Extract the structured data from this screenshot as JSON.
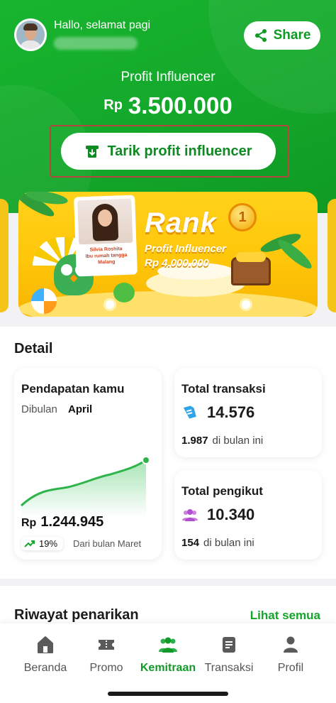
{
  "header": {
    "greeting": "Hallo, selamat pagi",
    "share_label": "Share",
    "profit_label": "Profit Influencer",
    "currency": "Rp",
    "profit_amount": "3.500.000",
    "withdraw_label": "Tarik profit influencer"
  },
  "banner": {
    "title": "Rank",
    "subtitle": "Profit Influencer",
    "amount": "Rp 4.000.000",
    "medal_number": "1",
    "photo_caption": "Silvia Roshita\nIbu rumah tangga\nMalang"
  },
  "detail": {
    "title": "Detail",
    "income": {
      "title": "Pendapatan kamu",
      "period_label": "Dibulan",
      "month": "April",
      "currency": "Rp",
      "amount": "1.244.945",
      "trend_percent": "19%",
      "trend_text": "Dari bulan Maret"
    },
    "transactions": {
      "title": "Total transaksi",
      "value": "14.576",
      "month_value": "1.987",
      "month_text": "di bulan ini"
    },
    "followers": {
      "title": "Total pengikut",
      "value": "10.340",
      "month_value": "154",
      "month_text": "di bulan ini"
    }
  },
  "riwayat": {
    "title": "Riwayat penarikan",
    "see_all": "Lihat semua"
  },
  "bottom_nav": {
    "items": [
      {
        "label": "Beranda",
        "icon": "home-icon"
      },
      {
        "label": "Promo",
        "icon": "ticket-icon"
      },
      {
        "label": "Kemitraan",
        "icon": "partners-icon"
      },
      {
        "label": "Transaksi",
        "icon": "receipt-icon"
      },
      {
        "label": "Profil",
        "icon": "person-icon"
      }
    ],
    "active": "Kemitraan"
  },
  "colors": {
    "brand_green": "#13a62a",
    "banner_yellow": "#ffc60a",
    "withdraw_highlight_border": "#b4463f"
  }
}
